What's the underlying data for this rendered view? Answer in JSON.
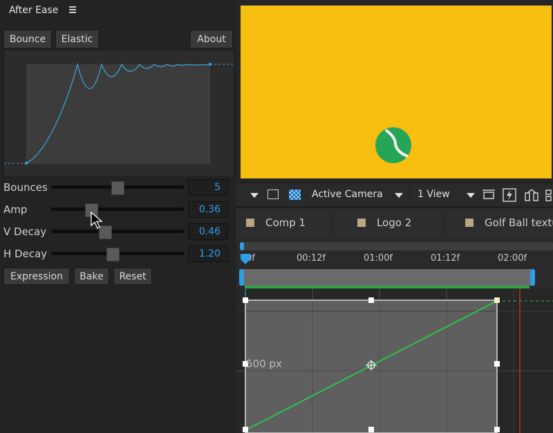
{
  "panel": {
    "title": "After Ease",
    "presets": {
      "bounce": "Bounce",
      "elastic": "Elastic",
      "about": "About"
    },
    "params": [
      {
        "label": "Bounces",
        "value": "5",
        "level": 0.63
      },
      {
        "label": "Amp",
        "value": "0.36",
        "level": 0.32
      },
      {
        "label": "V Decay",
        "value": "0.46",
        "level": 0.42
      },
      {
        "label": "H Decay",
        "value": "1.20",
        "level": 0.49
      }
    ],
    "actions": {
      "expression": "Expression",
      "bake": "Bake",
      "reset": "Reset"
    }
  },
  "viewer": {
    "stage_color": "#f7bf0f",
    "ball_color": "#27a556",
    "camera": "Active Camera",
    "views": "1 View"
  },
  "tabs": [
    {
      "label": "Comp 1"
    },
    {
      "label": "Logo 2"
    },
    {
      "label": "Golf Ball textu"
    }
  ],
  "timeline": {
    "ticks": [
      "0f",
      "00:12f",
      "01:00f",
      "01:12f",
      "02:00f"
    ],
    "value_label": "500 px"
  },
  "colors": {
    "accent": "#2e9ee6",
    "curve": "#3aa0d8",
    "ease_line": "#2ec24a",
    "playhead": "#c0282a"
  }
}
